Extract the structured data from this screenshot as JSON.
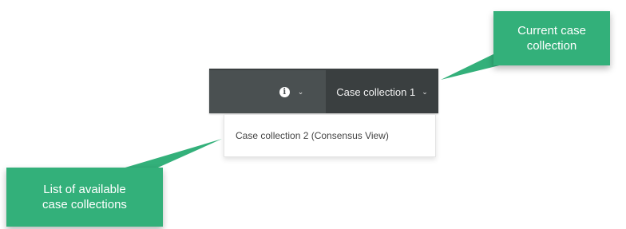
{
  "toolbar": {
    "info_icon_glyph": "i",
    "info_icon": "info-icon",
    "caret_glyph": "⌄",
    "current_collection": "Case collection 1"
  },
  "dropdown": {
    "items": [
      {
        "label": "Case collection 2 (Consensus View)"
      }
    ]
  },
  "callouts": {
    "current": {
      "lines": [
        "Current case",
        "collection"
      ]
    },
    "list": {
      "lines": [
        "List of available",
        "case collections"
      ]
    }
  },
  "colors": {
    "toolbar_bg": "#4a5051",
    "toolbar_active_bg": "#3a3f40",
    "callout_green": "#33b07a"
  }
}
